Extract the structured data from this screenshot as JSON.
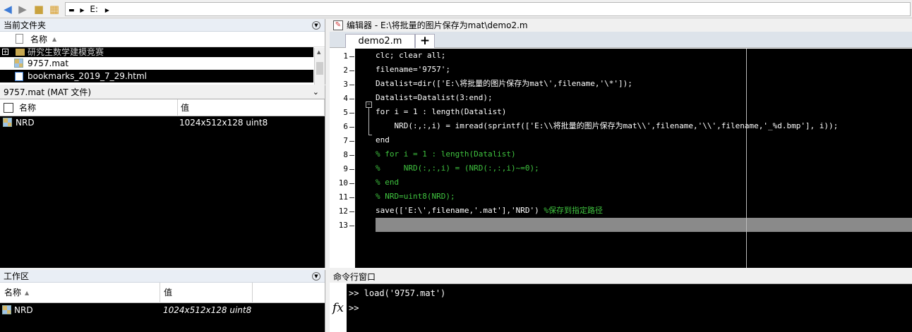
{
  "topbar": {
    "back_icon": "arrow-left-icon",
    "forward_icon": "arrow-right-icon",
    "up_icon": "folder-up-icon",
    "browse_icon": "browse-folder-icon",
    "path": "E:"
  },
  "current_folder": {
    "title": "当前文件夹",
    "column_name": "名称",
    "items": [
      {
        "name": "研究生数学建模竞赛",
        "icon": "folder-icon"
      },
      {
        "name": "9757.mat",
        "icon": "mat-file-icon"
      },
      {
        "name": "bookmarks_2019_7_29.html",
        "icon": "html-file-icon"
      }
    ]
  },
  "details": {
    "title": "9757.mat  (MAT 文件)",
    "col_name": "名称",
    "col_value": "值",
    "rows": [
      {
        "name": "NRD",
        "value": "1024x512x128 uint8"
      }
    ]
  },
  "workspace": {
    "title": "工作区",
    "col_name": "名称",
    "col_value": "值",
    "rows": [
      {
        "name": "NRD",
        "value": "1024x512x128 uint8"
      }
    ]
  },
  "editor": {
    "title": "编辑器 - E:\\将批量的图片保存为mat\\demo2.m",
    "tab_label": "demo2.m",
    "add_tab": "+",
    "lines": [
      {
        "n": "1",
        "code": "clc; clear all;",
        "type": "code"
      },
      {
        "n": "2",
        "code": "filename='9757';",
        "type": "code"
      },
      {
        "n": "3",
        "code": "Datalist=dir(['E:\\将批量的图片保存为mat\\',filename,'\\*']);",
        "type": "code"
      },
      {
        "n": "4",
        "code": "Datalist=Datalist(3:end);",
        "type": "code"
      },
      {
        "n": "5",
        "code": "for i = 1 : length(Datalist)",
        "type": "code"
      },
      {
        "n": "6",
        "code": "    NRD(:,:,i) = imread(sprintf(['E:\\\\将批量的图片保存为mat\\\\',filename,'\\\\',filename,'_%d.bmp'], i));",
        "type": "code"
      },
      {
        "n": "7",
        "code": "end",
        "type": "code"
      },
      {
        "n": "8",
        "code": "% for i = 1 : length(Datalist)",
        "type": "comment"
      },
      {
        "n": "9",
        "code": "%     NRD(:,:,i) = (NRD(:,:,i)~=0);",
        "type": "comment"
      },
      {
        "n": "10",
        "code": "% end",
        "type": "comment"
      },
      {
        "n": "11",
        "code": "% NRD=uint8(NRD);",
        "type": "comment"
      },
      {
        "n": "12",
        "code": "save(['E:\\',filename,'.mat'],'NRD') ",
        "comment": "%保存到指定路径",
        "type": "mixed"
      },
      {
        "n": "13",
        "code": "",
        "type": "code"
      }
    ]
  },
  "command_window": {
    "title": "命令行窗口",
    "fx": "fx",
    "history": [
      ">> load('9757.mat')"
    ],
    "prompt": ">>"
  }
}
